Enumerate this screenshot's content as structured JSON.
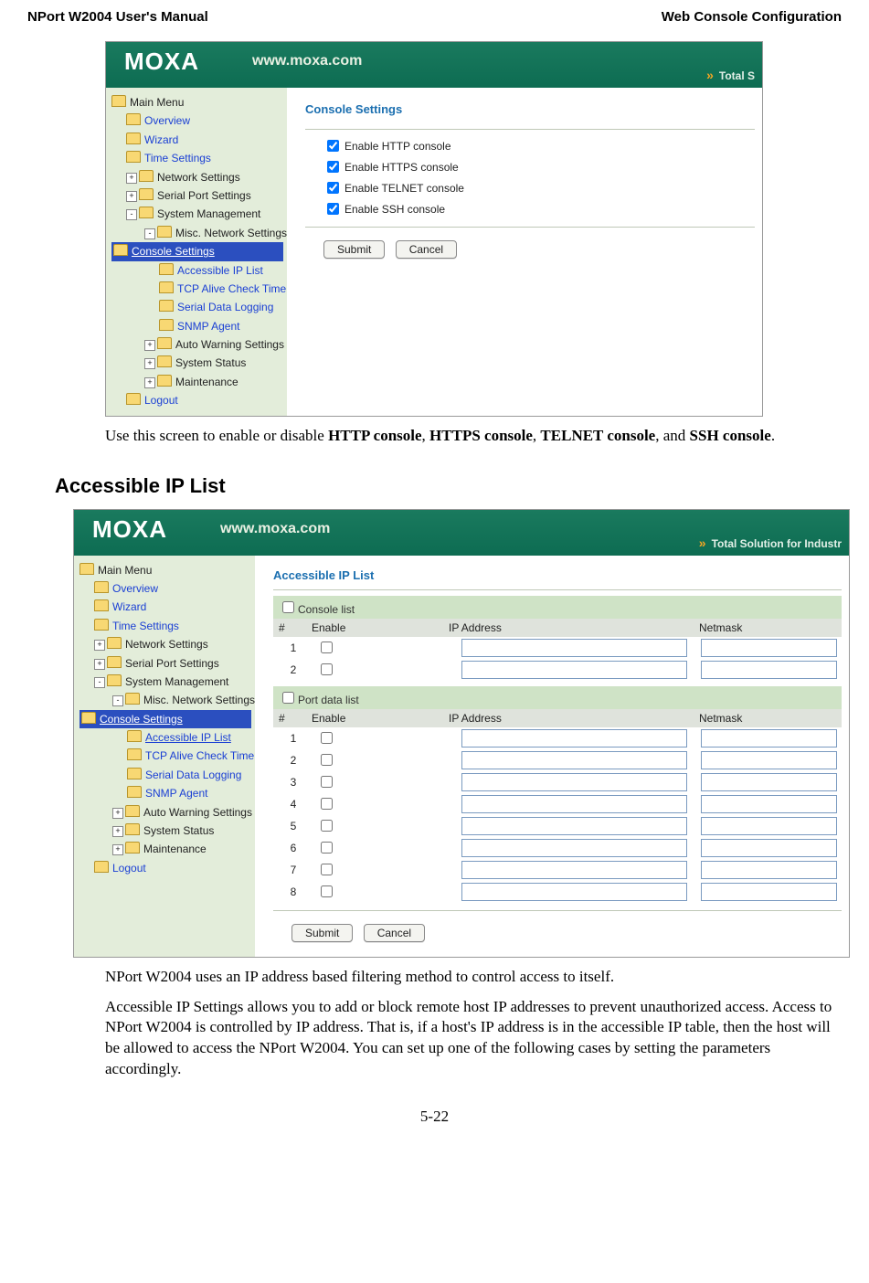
{
  "page": {
    "header_left": "NPort W2004 User's Manual",
    "header_right": "Web Console Configuration",
    "page_number": "5-22"
  },
  "shot1": {
    "logo": "MOXA",
    "url": "www.moxa.com",
    "banner_right": "Total S",
    "tree": {
      "root": "Main Menu",
      "overview": "Overview",
      "wizard": "Wizard",
      "time": "Time Settings",
      "network": "Network Settings",
      "serial": "Serial Port Settings",
      "sysmgmt": "System Management",
      "misc": "Misc. Network Settings",
      "console_settings": "Console Settings",
      "accessible_ip": "Accessible IP List",
      "tcp_alive": "TCP Alive Check Time",
      "serial_log": "Serial Data Logging",
      "snmp": "SNMP Agent",
      "autowarn": "Auto Warning Settings",
      "sysstatus": "System Status",
      "maint": "Maintenance",
      "logout": "Logout"
    },
    "pane_title": "Console Settings",
    "chk_http": "Enable HTTP console",
    "chk_https": "Enable HTTPS console",
    "chk_telnet": "Enable TELNET console",
    "chk_ssh": "Enable SSH console",
    "btn_submit": "Submit",
    "btn_cancel": "Cancel"
  },
  "para1_pre": "Use this screen to enable or disable ",
  "para1_b1": "HTTP console",
  "para1_s1": ", ",
  "para1_b2": "HTTPS console",
  "para1_s2": ", ",
  "para1_b3": "TELNET console",
  "para1_s3": ", and ",
  "para1_b4": "SSH console",
  "para1_s4": ".",
  "section2_title": "Accessible IP List",
  "shot2": {
    "logo": "MOXA",
    "url": "www.moxa.com",
    "banner_right": "Total Solution for Industr",
    "tree": {
      "root": "Main Menu",
      "overview": "Overview",
      "wizard": "Wizard",
      "time": "Time Settings",
      "network": "Network Settings",
      "serial": "Serial Port Settings",
      "sysmgmt": "System Management",
      "misc": "Misc. Network Settings",
      "console_settings": "Console Settings",
      "accessible_ip": "Accessible IP List",
      "tcp_alive": "TCP Alive Check Time",
      "serial_log": "Serial Data Logging",
      "snmp": "SNMP Agent",
      "autowarn": "Auto Warning Settings",
      "sysstatus": "System Status",
      "maint": "Maintenance",
      "logout": "Logout"
    },
    "pane_title": "Accessible IP List",
    "console_list_title": "Console list",
    "port_list_title": "Port data list",
    "col_num": "#",
    "col_enable": "Enable",
    "col_ip": "IP Address",
    "col_netmask": "Netmask",
    "console_rows": [
      "1",
      "2"
    ],
    "port_rows": [
      "1",
      "2",
      "3",
      "4",
      "5",
      "6",
      "7",
      "8"
    ],
    "btn_submit": "Submit",
    "btn_cancel": "Cancel"
  },
  "para2": "NPort W2004 uses an IP address based filtering method to control access to itself.",
  "para3": "Accessible IP Settings allows you to add or block remote host IP addresses to prevent unauthorized access. Access to NPort W2004 is controlled by IP address. That is, if a host's IP address is in the accessible IP table, then the host will be allowed to access the NPort W2004. You can set up one of the following cases by setting the parameters accordingly."
}
